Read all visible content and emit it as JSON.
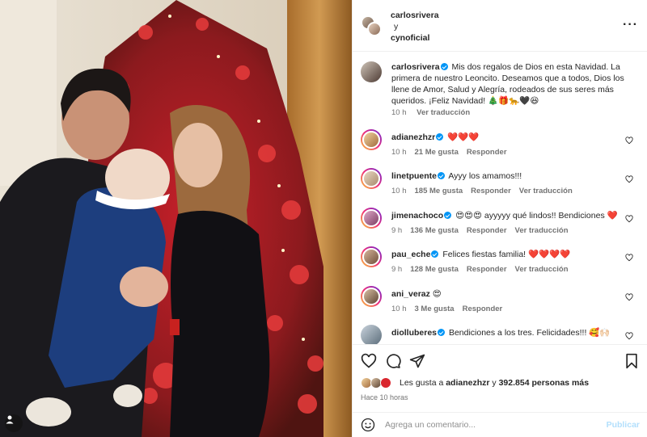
{
  "post": {
    "header": {
      "user1": "carlosrivera",
      "conj": "y",
      "user2": "cynoficial"
    },
    "caption": {
      "user": "carlosrivera",
      "text": "Mis dos regalos de Dios en esta Navidad. La primera de nuestro Leoncito. Deseamos que a todos, Dios los llene de Amor, Salud y Alegría, rodeados de sus seres más queridos. ¡Feliz Navidad! 🎄🎁🐆🖤😆",
      "time": "10 h",
      "translate": "Ver traducción"
    },
    "comments": [
      {
        "user": "adianezhzr",
        "text": "❤️❤️❤️",
        "time": "10 h",
        "likes": "21 Me gusta",
        "reply": "Responder",
        "translate": ""
      },
      {
        "user": "linetpuente",
        "text": "Ayyy los amamos!!!",
        "time": "10 h",
        "likes": "185 Me gusta",
        "reply": "Responder",
        "translate": "Ver traducción"
      },
      {
        "user": "jimenachoco",
        "text": "😍😍😍 ayyyyy qué lindos!! Bendiciones ❤️",
        "time": "9 h",
        "likes": "136 Me gusta",
        "reply": "Responder",
        "translate": "Ver traducción"
      },
      {
        "user": "pau_eche",
        "text": "Felices fiestas familia! ❤️❤️❤️❤️",
        "time": "9 h",
        "likes": "128 Me gusta",
        "reply": "Responder",
        "translate": "Ver traducción"
      },
      {
        "user": "ani_veraz",
        "text": "😍",
        "time": "10 h",
        "likes": "3 Me gusta",
        "reply": "Responder",
        "translate": ""
      },
      {
        "user": "diolluberes",
        "text": "Bendiciones a los tres. Felicidades!!! 🥰🙌🏻",
        "time": "",
        "likes": "",
        "reply": "",
        "translate": ""
      }
    ],
    "likes": {
      "prefix": "Les gusta a",
      "user": "adianezhzr",
      "middle": "y",
      "count": "392.854 personas más"
    },
    "time_ago": "Hace 10 horas",
    "add_comment": {
      "placeholder": "Agrega un comentario...",
      "publish": "Publicar"
    }
  },
  "icons": [
    "heart-icon",
    "comment-icon",
    "share-icon",
    "bookmark-icon",
    "more-icon",
    "emoji-icon",
    "user-tag-icon"
  ],
  "colors": {
    "verified": "#0095f6",
    "publish_disabled": "#b2dffc",
    "muted": "#737373"
  }
}
